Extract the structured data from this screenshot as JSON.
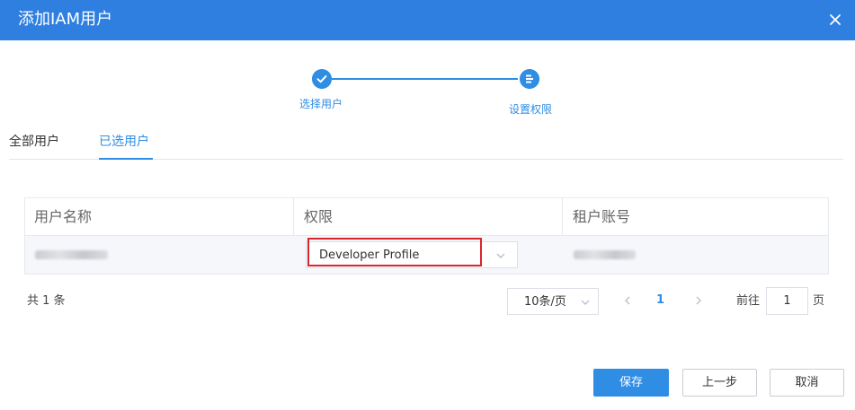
{
  "dialog": {
    "title": "添加IAM用户"
  },
  "steps": [
    {
      "label": "选择用户",
      "status": "done"
    },
    {
      "label": "设置权限",
      "status": "current"
    }
  ],
  "tabs": [
    {
      "label": "全部用户",
      "active": false
    },
    {
      "label": "已选用户",
      "active": true
    }
  ],
  "table": {
    "columns": [
      "用户名称",
      "权限",
      "租户账号"
    ],
    "rows": [
      {
        "user_name": "",
        "permission": "Developer Profile",
        "tenant_account": ""
      }
    ]
  },
  "pagination": {
    "total": "共 1 条",
    "page_size": "10条/页",
    "current_page": "1",
    "goto_label": "前往",
    "goto_value": "1",
    "page_unit": "页"
  },
  "buttons": {
    "save": "保存",
    "prev": "上一步",
    "cancel": "取消"
  },
  "colors": {
    "header": "#2f7fe0",
    "accent": "#2f8de4",
    "highlight": "#d9262c"
  }
}
